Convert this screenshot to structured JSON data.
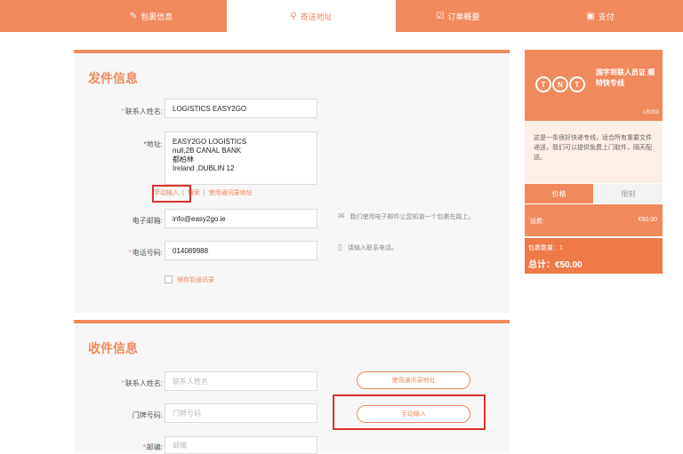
{
  "steps": [
    {
      "label": "包裹信息",
      "icon": "edit-icon"
    },
    {
      "label": "寄送地址",
      "icon": "location-pin-icon"
    },
    {
      "label": "订单概要",
      "icon": "checklist-icon"
    },
    {
      "label": "支付",
      "icon": "payment-card-icon"
    }
  ],
  "sender": {
    "title": "发件信息",
    "contact_label": "联系人姓名:",
    "contact_value": "LOGISTICS EASY2GO",
    "address_label": "*地址:",
    "address_lines": [
      "EASY2GO LOGISTICS",
      "null,2B CANAL BANK",
      "都柏林",
      "Ireland ,DUBLIN 12"
    ],
    "address_links": {
      "manual": "手动输入",
      "search": "搜索",
      "use_book": "使用通讯录地址"
    },
    "email_label": "电子邮箱:",
    "email_value": "info@easy2go.ie",
    "email_hint": "我们使用电子邮件让您知道一个包裹在路上。",
    "phone_label": "电话号码:",
    "phone_value": "014089988",
    "phone_hint": "请输入联系电话。",
    "save_label": "保存到通讯录"
  },
  "receiver": {
    "title": "收件信息",
    "contact_label": "联系人姓名:",
    "contact_placeholder": "联系人姓名",
    "door_label": "门牌号码:",
    "door_placeholder": "门牌号码",
    "zip_label": "邮编:",
    "zip_placeholder": "邮编",
    "use_book_button": "使用通讯录地址",
    "manual_button": "手动输入"
  },
  "product": {
    "brand_letters": [
      "T",
      "N",
      "T"
    ],
    "title": "国字到联人员证 顺特快专线",
    "code": "LR203",
    "description": "这是一条很好快递专线，适合所有重要文件递送，我们可以提供免费上门取件，隔天配送。",
    "tabs": [
      "价格",
      "限制"
    ],
    "price_label": "运费:",
    "price_value": "€50.00",
    "count_text": "包裹数量：1",
    "total_text": "总计：€50.00"
  },
  "colors": {
    "accent": "#f08a5d",
    "highlight_box": "#d9322b"
  }
}
